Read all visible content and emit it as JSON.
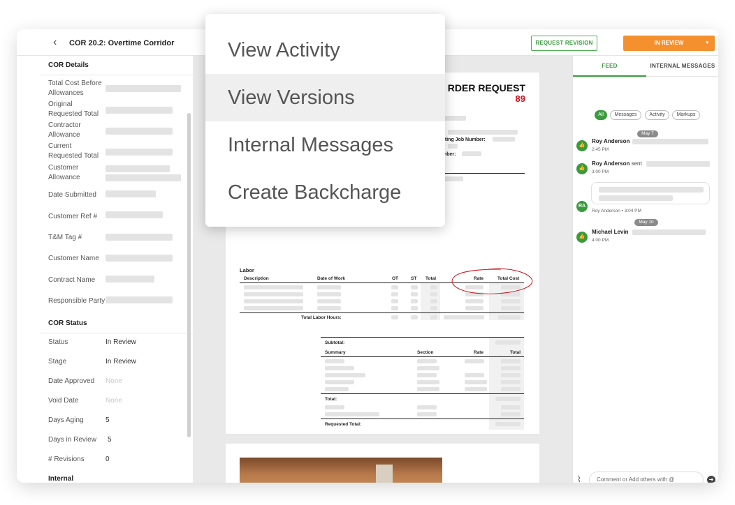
{
  "header": {
    "back_glyph": "‹",
    "title": "COR 20.2: Overtime Corridor",
    "request_revision": "REQUEST REVISION",
    "status_label": "IN REVIEW",
    "status_caret": "▾",
    "accent_color": "#f5902f",
    "green_color": "#3a9b3e"
  },
  "details": {
    "section": "COR Details",
    "labels": [
      "Total Cost Before Allowances",
      "Original Requested Total",
      "Contractor Allowance",
      "Current Requested Total",
      "Customer Allowance",
      "Date Submitted",
      "Customer Ref #",
      "T&M Tag #",
      "Customer Name",
      "Contract Name",
      "Responsible Party"
    ]
  },
  "status": {
    "section": "COR Status",
    "rows": [
      {
        "label": "Status",
        "value": "In Review"
      },
      {
        "label": "Stage",
        "value": "In Review"
      },
      {
        "label": "Date Approved",
        "value": "None"
      },
      {
        "label": "Void Date",
        "value": "None"
      },
      {
        "label": "Days Aging",
        "value": "5"
      },
      {
        "label": "Days in Review",
        "value": "5"
      },
      {
        "label": "# Revisions",
        "value": "0"
      }
    ],
    "next_section": "Internal"
  },
  "document": {
    "title": "RDER REQUEST",
    "number": "89",
    "field_job": "cting Job Number:",
    "field_num": "mber:",
    "labor": {
      "heading": "Labor",
      "cols": [
        "Description",
        "Date of Work",
        "OT",
        "ST",
        "Total",
        "Rate",
        "Total Cost"
      ],
      "total_hours": "Total Labor Hours:"
    },
    "summary": {
      "subtotal": "Subtotal:",
      "cols": [
        "Summary",
        "Section",
        "Rate",
        "Total"
      ],
      "total": "Total:",
      "requested_total": "Requested Total:"
    }
  },
  "menu": {
    "items": [
      "View Activity",
      "View Versions",
      "Internal Messages",
      "Create Backcharge"
    ],
    "highlighted": 1
  },
  "feed": {
    "tabs": [
      "FEED",
      "INTERNAL MESSAGES"
    ],
    "filters": [
      "All",
      "Messages",
      "Activity",
      "Markups"
    ],
    "date1": "May 7",
    "items": [
      {
        "name": "Roy Anderson",
        "time": "2:45 PM",
        "avatar_icon": "thumbs-up-icon"
      },
      {
        "name": "Roy Anderson",
        "verb": "sent",
        "time": "3:00 PM",
        "avatar_icon": "thumbs-up-icon"
      }
    ],
    "bubble_initials": "RA",
    "bubble_meta": "Roy Anderson • 3:04 PM",
    "date2": "May 10",
    "item3": {
      "name": "Michael Levin",
      "time": "4:00 PM",
      "avatar_icon": "thumbs-up-icon"
    },
    "comment_placeholder": "Comment or Add others with @",
    "attach_glyph": "⌇",
    "send_glyph": "➜",
    "thumb_glyph": "👍"
  }
}
